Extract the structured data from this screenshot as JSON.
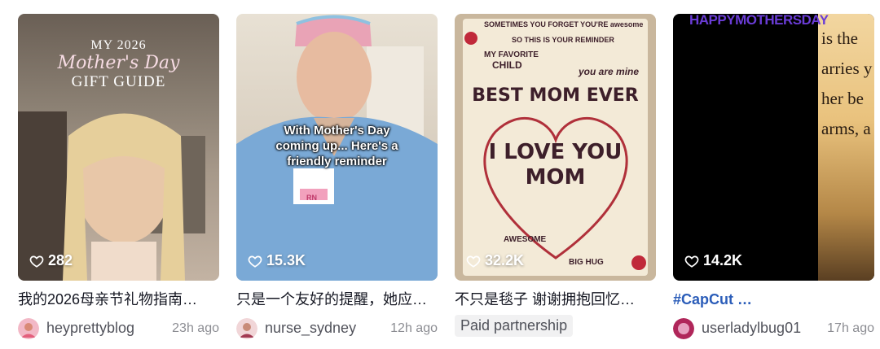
{
  "cards": [
    {
      "likes": "282",
      "title": "我的2026母亲节礼物指南…",
      "username": "heyprettyblog",
      "time": "23h ago",
      "overlay": {
        "line1": "MY 2026",
        "line2": "Mother's Day",
        "line3": "GIFT GUIDE"
      }
    },
    {
      "likes": "15.3K",
      "title": "只是一个友好的提醒，她应…",
      "username": "nurse_sydney",
      "time": "12h ago",
      "overlay": {
        "caption": "With Mother's Day coming up... Here's a friendly reminder",
        "badge": "RN"
      }
    },
    {
      "likes": "32.2K",
      "title": "不只是毯子 谢谢拥抱回忆…",
      "badge": "Paid partnership",
      "overlay": {
        "top1": "SOMETIMES YOU FORGET YOU'RE awesome",
        "top2": "SO THIS IS YOUR REMINDER",
        "fav": "MY FAVORITE",
        "child": "CHILD",
        "youare": "you are mine",
        "best": "BEST MOM EVER",
        "ily": "I LOVE YOU",
        "mom": "MOM",
        "awesome": "AWESOME",
        "hug": "BIG HUG"
      }
    },
    {
      "likes": "14.2K",
      "title": "#CapCut …",
      "username": "userladylbug01",
      "time": "17h ago",
      "overlay": {
        "banner": "HAPPYMOTHERSDAY",
        "lines": [
          "is the",
          "arries y",
          "her be",
          "arms, a"
        ]
      }
    }
  ]
}
